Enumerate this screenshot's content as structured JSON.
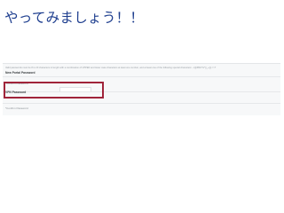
{
  "slide": {
    "title": "やってみましょう！！"
  },
  "form": {
    "rule_text": "Valid passwords must be 8 to 20 characters in length with a combination of UPPER and lower case characters at least one number, and at least one of the following special characters: ~!@#$%^&*()_+{}|:<>?",
    "new_portal_heading": "New Portal Password",
    "confirm_portal_label": "*Confirm Password",
    "vpn_heading": "VPN Password",
    "confirm_vpn_label": "*Confirm Password"
  },
  "colors": {
    "title": "#1f3f8f",
    "highlight": "#a0243a"
  }
}
